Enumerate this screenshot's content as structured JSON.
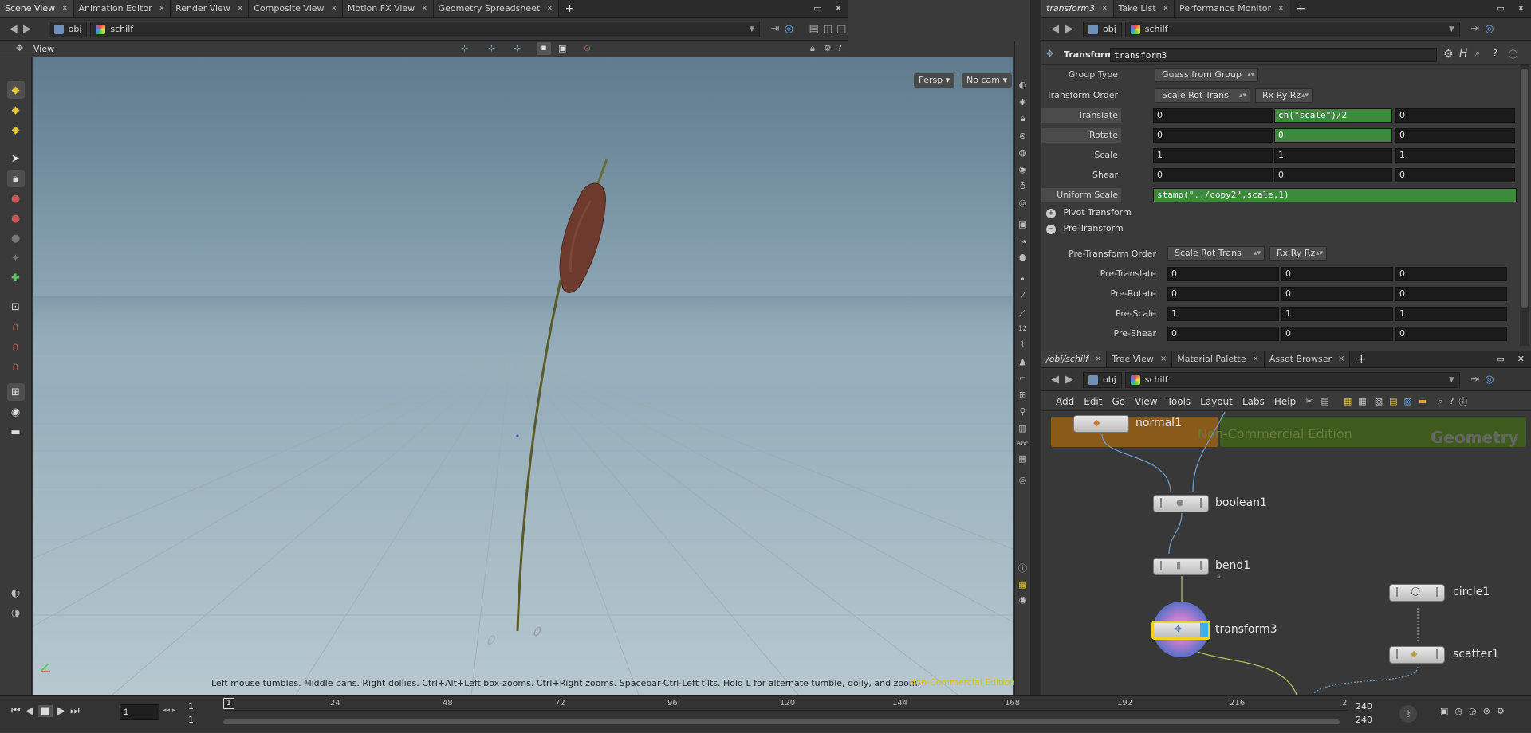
{
  "left_tabs": [
    {
      "label": "Scene View"
    },
    {
      "label": "Animation Editor"
    },
    {
      "label": "Render View"
    },
    {
      "label": "Composite View"
    },
    {
      "label": "Motion FX View"
    },
    {
      "label": "Geometry Spreadsheet"
    }
  ],
  "right_tabs": [
    {
      "label": "transform3"
    },
    {
      "label": "Take List"
    },
    {
      "label": "Performance Monitor"
    }
  ],
  "network_tabs": [
    {
      "label": "/obj/schilf"
    },
    {
      "label": "Tree View"
    },
    {
      "label": "Material Palette"
    },
    {
      "label": "Asset Browser"
    }
  ],
  "path": {
    "obj": "obj",
    "node": "schilf"
  },
  "viewport": {
    "title": "View",
    "persp": "Persp",
    "cam": "No cam",
    "status": "Left mouse tumbles. Middle pans. Right dollies. Ctrl+Alt+Left box-zooms. Ctrl+Right zooms. Spacebar-Ctrl-Left tilts. Hold L for alternate tumble, dolly, and zoom.",
    "watermark": "Non-Commercial Edition",
    "ground_labels": [
      "0",
      "0"
    ]
  },
  "params": {
    "op_type": "Transform",
    "op_name": "transform3",
    "group_type_label": "Group Type",
    "group_type_value": "Guess from Group",
    "order_label": "Transform Order",
    "order_value": "Scale Rot Trans",
    "rot_order_value": "Rx Ry Rz",
    "translate_label": "Translate",
    "translate": [
      "0",
      "ch(\"scale\")/2",
      "0"
    ],
    "rotate_label": "Rotate",
    "rotate": [
      "0",
      "0",
      "0"
    ],
    "scale_label": "Scale",
    "scale": [
      "1",
      "1",
      "1"
    ],
    "shear_label": "Shear",
    "shear": [
      "0",
      "0",
      "0"
    ],
    "uniform_label": "Uniform Scale",
    "uniform_value": "stamp(\"../copy2\",scale,1)",
    "pivot_folder": "Pivot Transform",
    "pre_folder": "Pre-Transform",
    "pre_order_label": "Pre-Transform Order",
    "pre_order_value": "Scale Rot Trans",
    "pre_rot_order_value": "Rx Ry Rz",
    "pre_translate_label": "Pre-Translate",
    "pre_translate": [
      "0",
      "0",
      "0"
    ],
    "pre_rotate_label": "Pre-Rotate",
    "pre_rotate": [
      "0",
      "0",
      "0"
    ],
    "pre_scale_label": "Pre-Scale",
    "pre_scale": [
      "1",
      "1",
      "1"
    ],
    "pre_shear_label": "Pre-Shear",
    "pre_shear": [
      "0",
      "0",
      "0"
    ]
  },
  "network_menu": [
    "Add",
    "Edit",
    "Go",
    "View",
    "Tools",
    "Layout",
    "Labs",
    "Help"
  ],
  "network": {
    "watermark": "Non-Commercial Edition",
    "context": "Geometry",
    "nodes": {
      "normal1": "normal1",
      "boolean1": "boolean1",
      "bend1": "bend1",
      "transform3": "transform3",
      "circle1": "circle1",
      "scatter1": "scatter1"
    }
  },
  "timeline": {
    "frame": "1",
    "start": "1",
    "start2": "1",
    "end": "240",
    "end2": "240",
    "current_marker": "1",
    "ticks": [
      "24",
      "48",
      "72",
      "96",
      "120",
      "144",
      "168",
      "192",
      "216",
      "2"
    ]
  },
  "colors": {
    "accent_green": "#3c8a3c",
    "node_select": "#f2d21b",
    "watermark": "#d8c400"
  }
}
